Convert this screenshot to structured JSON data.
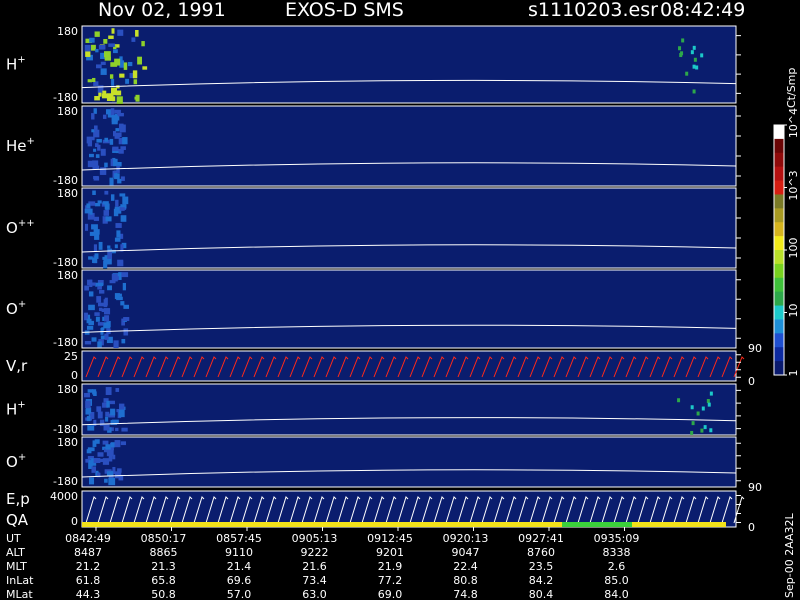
{
  "header": {
    "date": "Nov 02, 1991",
    "instrument": "EXOS-D SMS",
    "file": "s1110203.esr",
    "time": "08:42:49"
  },
  "footer_note": "Sep-00 2AA32L",
  "colorbar": {
    "label": "Ct/Smp",
    "scale": "log",
    "ticks": [
      "1",
      "10",
      "100",
      "10^3",
      "10^4"
    ],
    "colors": [
      "#0a1a6e",
      "#0d2aa0",
      "#1f4fd0",
      "#1e8fd8",
      "#1cc9c9",
      "#2da84a",
      "#3fc13a",
      "#78d21f",
      "#b9e02a",
      "#f2ea1a",
      "#d6b41e",
      "#a89a22",
      "#7a7a26",
      "#d61e12",
      "#b51010",
      "#8f0a0a",
      "#6a0505",
      "#ffffff"
    ]
  },
  "colors": {
    "background": "#0a1d6e",
    "trace": "#ffffff",
    "vel_trace": "#ff2a1a",
    "qa_base": "#f2e21a",
    "qa_good": "#3bd13b"
  },
  "chart_data": {
    "type": "heatmap",
    "title": "Nov 02, 1991   EXOS-D SMS",
    "time_axis": [
      "0842:49",
      "0850:17",
      "0857:45",
      "0905:13",
      "0912:45",
      "0920:13",
      "0927:41",
      "0935:09"
    ],
    "panels": [
      {
        "label": "H",
        "sup": "+",
        "ymax": "180",
        "ymin": "-180"
      },
      {
        "label": "He",
        "sup": "+",
        "ymax": "180",
        "ymin": "-180"
      },
      {
        "label": "O",
        "sup": "++",
        "ymax": "180",
        "ymin": "-180"
      },
      {
        "label": "O",
        "sup": "+",
        "ymax": "180",
        "ymin": "-180",
        "right_tick": "90"
      },
      {
        "label": "V,r",
        "sup": "",
        "ymax": "25",
        "ymin": "0",
        "right_tick": "0"
      },
      {
        "label": "H",
        "sup": "+",
        "ymax": "180",
        "ymin": "-180"
      },
      {
        "label": "O",
        "sup": "+",
        "ymax": "180",
        "ymin": "-180",
        "right_tick": "90"
      },
      {
        "label": "E,p",
        "label2": "QA",
        "sup": "",
        "ymax": "4000",
        "ymin": "0",
        "right_tick": "0"
      }
    ],
    "table": {
      "rows": [
        {
          "name": "UT",
          "values": [
            "0842:49",
            "0850:17",
            "0857:45",
            "0905:13",
            "0912:45",
            "0920:13",
            "0927:41",
            "0935:09"
          ]
        },
        {
          "name": "ALT",
          "values": [
            "8487",
            "8865",
            "9110",
            "9222",
            "9201",
            "9047",
            "8760",
            "8338"
          ]
        },
        {
          "name": "MLT",
          "values": [
            "21.2",
            "21.3",
            "21.4",
            "21.6",
            "21.9",
            "22.4",
            "23.5",
            "2.6"
          ]
        },
        {
          "name": "InLat",
          "values": [
            "61.8",
            "65.8",
            "69.6",
            "73.4",
            "77.2",
            "80.8",
            "84.2",
            "85.0"
          ]
        },
        {
          "name": "MLat",
          "values": [
            "44.3",
            "50.8",
            "57.0",
            "63.0",
            "69.0",
            "74.8",
            "80.4",
            "84.0"
          ]
        }
      ]
    }
  }
}
